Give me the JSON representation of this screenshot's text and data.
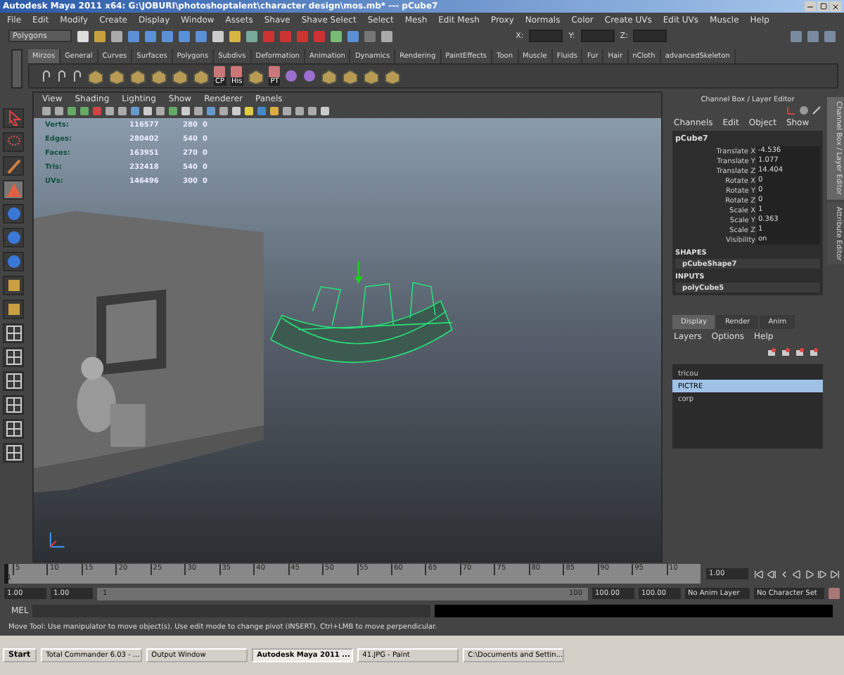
{
  "window": {
    "title": "Autodesk Maya 2011 x64: G:\\JOBURI\\photoshoptalent\\character design\\mos.mb*   ---   pCube7"
  },
  "menu": [
    "File",
    "Edit",
    "Modify",
    "Create",
    "Display",
    "Window",
    "Assets",
    "Shave",
    "Shave Select",
    "Select",
    "Mesh",
    "Edit Mesh",
    "Proxy",
    "Normals",
    "Color",
    "Create UVs",
    "Edit UVs",
    "Muscle",
    "Help"
  ],
  "status_line": {
    "mode": "Polygons",
    "fields": [
      "X:",
      "Y:",
      "Z:"
    ]
  },
  "shelf": {
    "tabs": [
      {
        "label": "Mirzos",
        "selected": true
      },
      {
        "label": "General",
        "selected": false
      },
      {
        "label": "Curves",
        "selected": false
      },
      {
        "label": "Surfaces",
        "selected": false
      },
      {
        "label": "Polygons",
        "selected": false
      },
      {
        "label": "Subdivs",
        "selected": false
      },
      {
        "label": "Deformation",
        "selected": false
      },
      {
        "label": "Animation",
        "selected": false
      },
      {
        "label": "Dynamics",
        "selected": false
      },
      {
        "label": "Rendering",
        "selected": false
      },
      {
        "label": "PaintEffects",
        "selected": false
      },
      {
        "label": "Toon",
        "selected": false
      },
      {
        "label": "Muscle",
        "selected": false
      },
      {
        "label": "Fluids",
        "selected": false
      },
      {
        "label": "Fur",
        "selected": false
      },
      {
        "label": "Hair",
        "selected": false
      },
      {
        "label": "nCloth",
        "selected": false
      },
      {
        "label": "advancedSkeleton",
        "selected": false
      }
    ],
    "tools": [
      {
        "kind": "hook"
      },
      {
        "kind": "hook"
      },
      {
        "kind": "hook"
      },
      {
        "kind": "cube"
      },
      {
        "kind": "cube"
      },
      {
        "kind": "cube"
      },
      {
        "kind": "cube"
      },
      {
        "kind": "cube"
      },
      {
        "kind": "cube"
      },
      {
        "kind": "labeled",
        "label": "CP"
      },
      {
        "kind": "labeled",
        "label": "His"
      },
      {
        "kind": "cube"
      },
      {
        "kind": "labeled",
        "label": "PT"
      },
      {
        "kind": "orb"
      },
      {
        "kind": "orb"
      },
      {
        "kind": "cube"
      },
      {
        "kind": "cube"
      },
      {
        "kind": "cube"
      },
      {
        "kind": "cube"
      }
    ]
  },
  "toolbox": [
    {
      "kind": "select",
      "selected": false
    },
    {
      "kind": "lasso",
      "selected": false
    },
    {
      "kind": "paint",
      "selected": false
    },
    {
      "kind": "move",
      "selected": true
    },
    {
      "kind": "sphere",
      "selected": false
    },
    {
      "kind": "sphere",
      "selected": false
    },
    {
      "kind": "sphere",
      "selected": false
    },
    {
      "kind": "cube",
      "selected": false
    },
    {
      "kind": "cube",
      "selected": false
    },
    {
      "kind": "layout",
      "selected": false
    },
    {
      "kind": "layout",
      "selected": false
    },
    {
      "kind": "layout",
      "selected": false
    },
    {
      "kind": "layout",
      "selected": false
    },
    {
      "kind": "layout",
      "selected": false
    },
    {
      "kind": "layout",
      "selected": false
    }
  ],
  "viewport": {
    "menu": [
      "View",
      "Shading",
      "Lighting",
      "Show",
      "Renderer",
      "Panels"
    ],
    "stats": [
      {
        "name": "Verts:",
        "values": [
          "116577",
          "280",
          "0"
        ]
      },
      {
        "name": "Edges:",
        "values": [
          "280402",
          "540",
          "0"
        ]
      },
      {
        "name": "Faces:",
        "values": [
          "163951",
          "270",
          "0"
        ]
      },
      {
        "name": "Tris:",
        "values": [
          "232418",
          "540",
          "0"
        ]
      },
      {
        "name": "UVs:",
        "values": [
          "146496",
          "300",
          "0"
        ]
      }
    ]
  },
  "channel_box": {
    "title": "Channel Box / Layer Editor",
    "menu": [
      "Channels",
      "Edit",
      "Object",
      "Show"
    ],
    "object": "pCube7",
    "attributes": [
      {
        "name": "Translate X",
        "value": "-4.536"
      },
      {
        "name": "Translate Y",
        "value": "1.077"
      },
      {
        "name": "Translate Z",
        "value": "14.404"
      },
      {
        "name": "Rotate X",
        "value": "0"
      },
      {
        "name": "Rotate Y",
        "value": "0"
      },
      {
        "name": "Rotate Z",
        "value": "0"
      },
      {
        "name": "Scale X",
        "value": "1"
      },
      {
        "name": "Scale Y",
        "value": "0.363"
      },
      {
        "name": "Scale Z",
        "value": "1"
      },
      {
        "name": "Visibility",
        "value": "on"
      }
    ],
    "shapes_heading": "SHAPES",
    "shapes": [
      "pCubeShape7"
    ],
    "inputs_heading": "INPUTS",
    "inputs": [
      "polyCube5"
    ]
  },
  "side_tabs": [
    {
      "label": "Channel Box / Layer Editor",
      "selected": true
    },
    {
      "label": "Attribute Editor",
      "selected": false
    }
  ],
  "layer_editor": {
    "tabs": [
      {
        "label": "Display",
        "selected": true
      },
      {
        "label": "Render",
        "selected": false
      },
      {
        "label": "Anim",
        "selected": false
      }
    ],
    "menu": [
      "Layers",
      "Options",
      "Help"
    ],
    "layers": [
      {
        "name": "tricou",
        "selected": false
      },
      {
        "name": "PICTRE",
        "selected": true
      },
      {
        "name": "corp",
        "selected": false
      }
    ]
  },
  "timeline": {
    "ticks": [
      "5",
      "10",
      "15",
      "20",
      "25",
      "30",
      "35",
      "40",
      "45",
      "50",
      "55",
      "60",
      "65",
      "70",
      "75",
      "80",
      "85",
      "90",
      "95",
      "10"
    ],
    "start": "1",
    "current": "1.00",
    "level": 0
  },
  "range": {
    "start": "1.00",
    "current": "1.00",
    "slider_start": "1",
    "slider_end": "100",
    "level": 1,
    "end": "100.00",
    "end_total": "100.00",
    "anim_layer": "No Anim Layer",
    "character_set": "No Character Set"
  },
  "command_line": {
    "label": "MEL"
  },
  "help_line": "Move Tool: Use manipulator to move object(s). Use edit mode to change pivot (INSERT). Ctrl+LMB to move perpendicular.",
  "taskbar": {
    "start": "Start",
    "tasks": [
      {
        "label": "Total Commander 6.03 - ...",
        "selected": false
      },
      {
        "label": "Output Window",
        "selected": false
      },
      {
        "label": "Autodesk Maya 2011 ...",
        "selected": true
      },
      {
        "label": "41.JPG - Paint",
        "selected": false
      },
      {
        "label": "C:\\Documents and Settin...",
        "selected": false
      }
    ]
  }
}
